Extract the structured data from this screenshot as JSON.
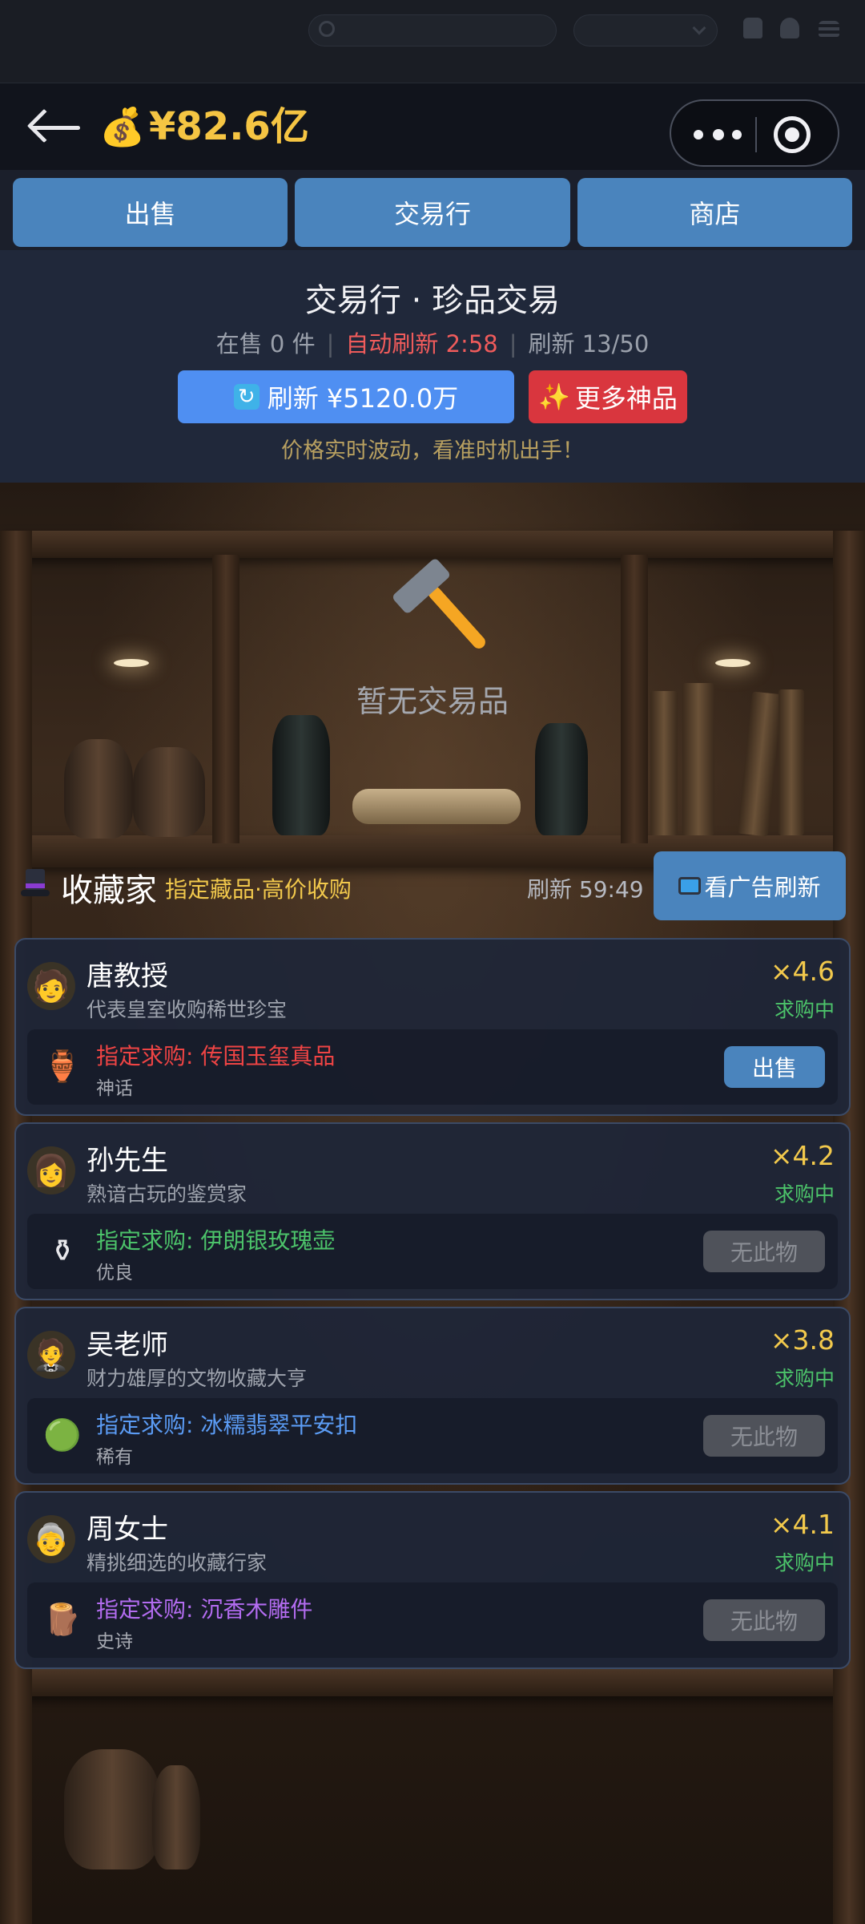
{
  "header": {
    "money_icon": "💰",
    "money": "¥82.6亿"
  },
  "tabs": [
    "出售",
    "交易行",
    "商店"
  ],
  "market": {
    "title": "交易行 · 珍品交易",
    "on_sale": "在售 0 件",
    "auto_refresh": "自动刷新 2:58",
    "refresh_count": "刷新 13/50",
    "refresh_button": "刷新 ¥5120.0万",
    "more_button": "更多神品",
    "hint": "价格实时波动，看准时机出手！"
  },
  "empty": {
    "icon": "hammer-icon",
    "text": "暂无交易品"
  },
  "collectors": {
    "title": "收藏家",
    "subtitle": "指定藏品·高价收购",
    "timer": "刷新 59:49",
    "ad_button": "看广告刷新",
    "cards": [
      {
        "name": "唐教授",
        "desc": "代表皇室收购稀世珍宝",
        "mult": "×4.6",
        "status": "求购中",
        "avatar": "🧑",
        "item_icon": "🏺",
        "req": "指定求购: 传国玉玺真品",
        "req_color": "#ef4444",
        "rarity": "神话",
        "action": "出售",
        "action_enabled": true
      },
      {
        "name": "孙先生",
        "desc": "熟谙古玩的鉴赏家",
        "mult": "×4.2",
        "status": "求购中",
        "avatar": "👩",
        "item_icon": "⚱",
        "req": "指定求购: 伊朗银玫瑰壶",
        "req_color": "#4cc36a",
        "rarity": "优良",
        "action": "无此物",
        "action_enabled": false
      },
      {
        "name": "吴老师",
        "desc": "财力雄厚的文物收藏大亨",
        "mult": "×3.8",
        "status": "求购中",
        "avatar": "🤵",
        "item_icon": "🟢",
        "req": "指定求购: 冰糯翡翠平安扣",
        "req_color": "#5b9cf5",
        "rarity": "稀有",
        "action": "无此物",
        "action_enabled": false
      },
      {
        "name": "周女士",
        "desc": "精挑细选的收藏行家",
        "mult": "×4.1",
        "status": "求购中",
        "avatar": "👵",
        "item_icon": "🪵",
        "req": "指定求购: 沉香木雕件",
        "req_color": "#b36cf0",
        "rarity": "史诗",
        "action": "无此物",
        "action_enabled": false
      }
    ]
  }
}
